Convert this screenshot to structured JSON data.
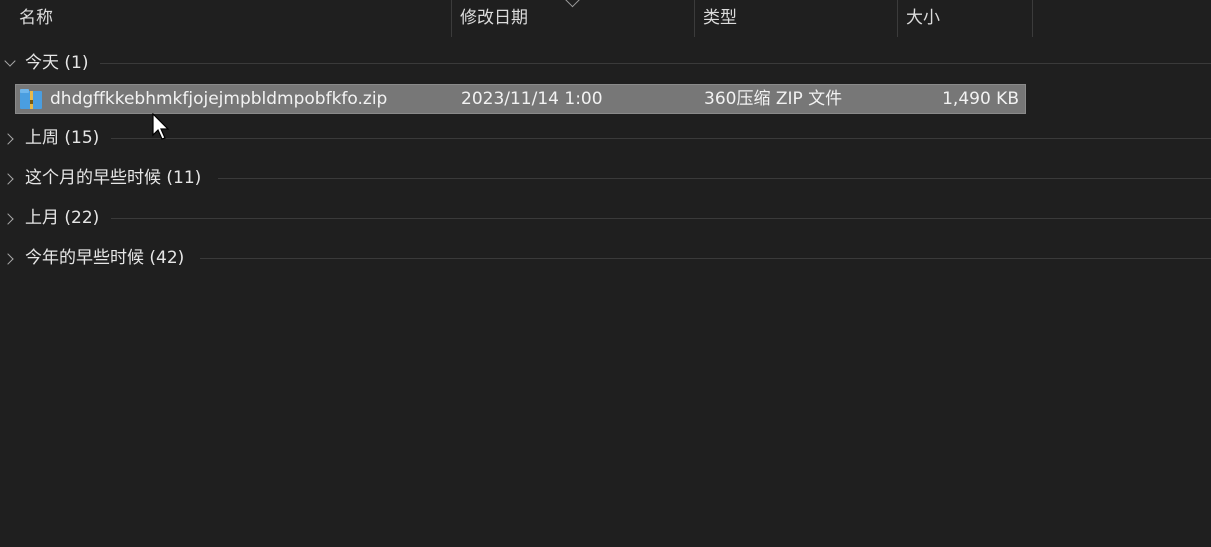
{
  "columns": {
    "name": "名称",
    "date_modified": "修改日期",
    "type": "类型",
    "size": "大小"
  },
  "groups": [
    {
      "label": "今天 (1)",
      "state": "expanded"
    },
    {
      "label": "上周 (15)",
      "state": "collapsed"
    },
    {
      "label": "这个月的早些时候 (11)",
      "state": "collapsed"
    },
    {
      "label": "上月 (22)",
      "state": "collapsed"
    },
    {
      "label": "今年的早些时候 (42)",
      "state": "collapsed"
    }
  ],
  "files": [
    {
      "name": "dhdgffkkebhmkfjojejmpbldmpobfkfo.zip",
      "date_modified": "2023/11/14 1:00",
      "type": "360压缩 ZIP 文件",
      "size": "1,490 KB",
      "icon": "zip-archive-icon",
      "selected": true
    }
  ],
  "colors": {
    "background": "#1f1f1f",
    "selection": "#777777",
    "text": "#e6e6e6",
    "divider": "#3a3a3a"
  }
}
